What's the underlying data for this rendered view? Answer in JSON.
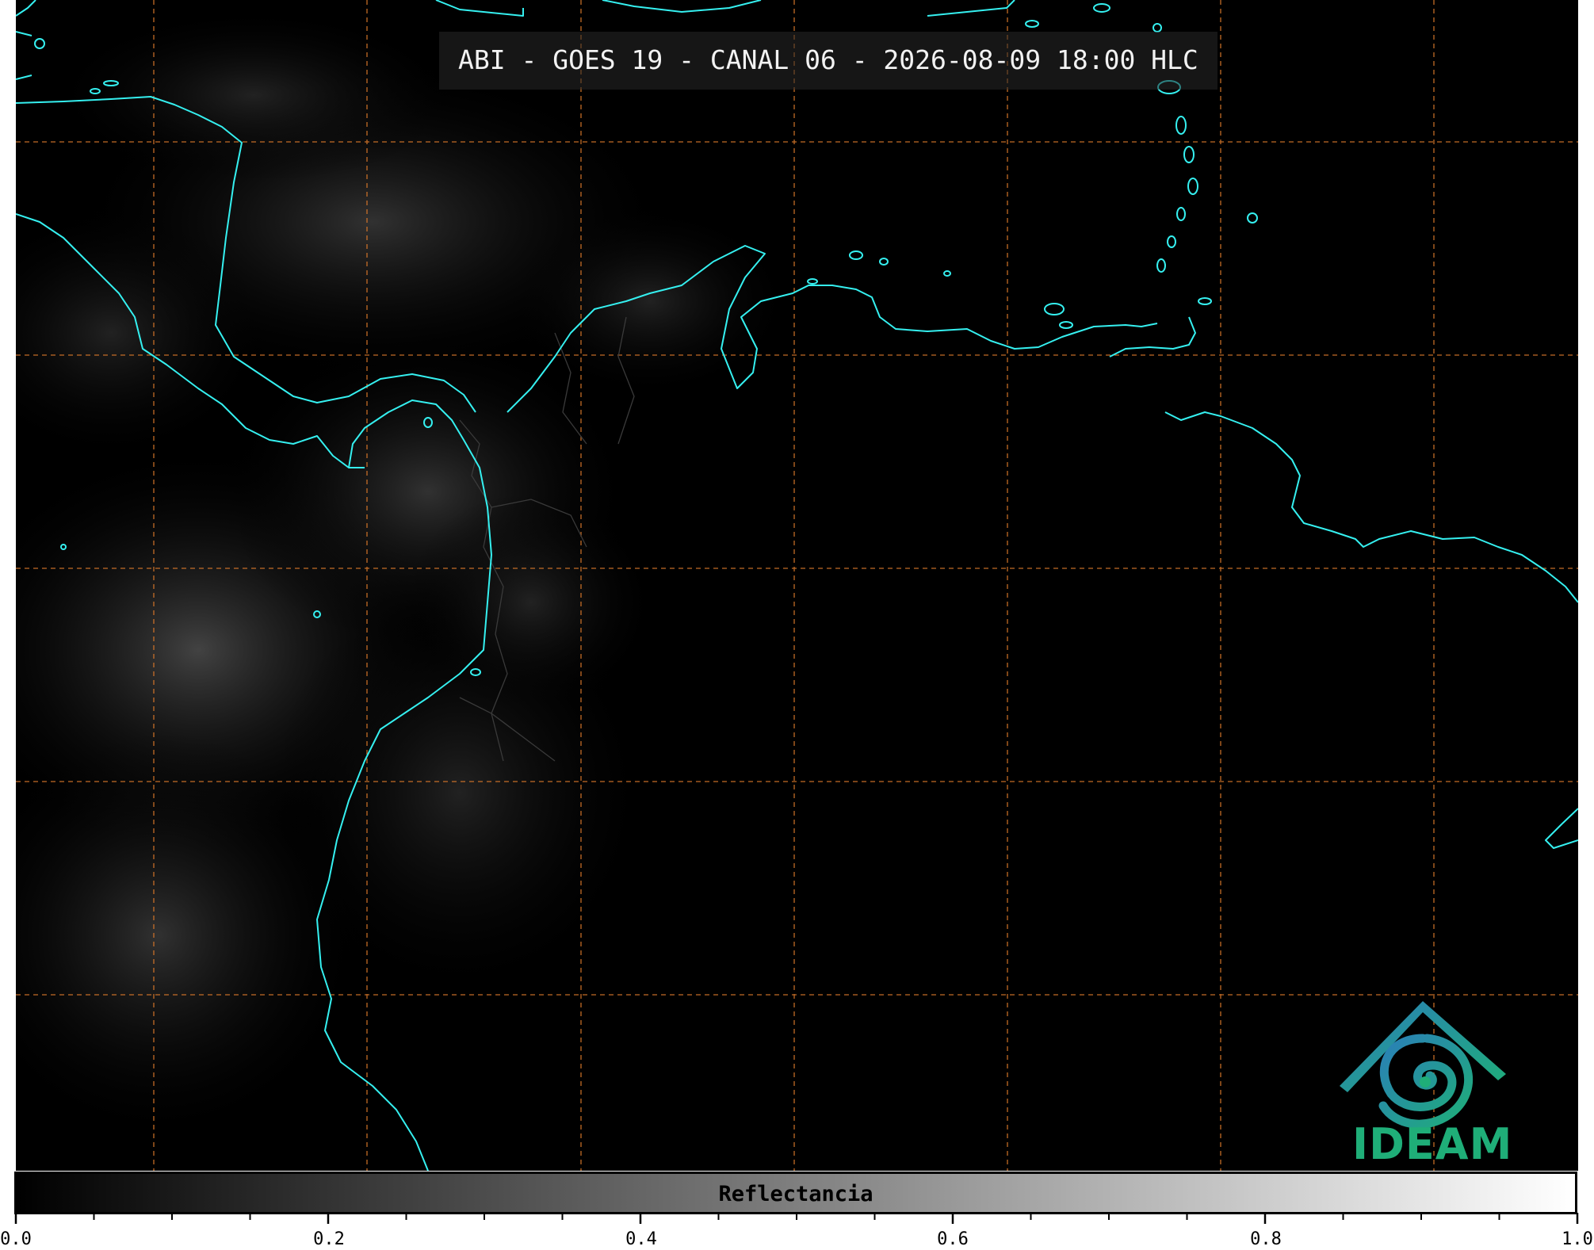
{
  "header": {
    "title": "ABI - GOES 19 - CANAL 06 - 2026-08-09 18:00 HLC"
  },
  "colorbar": {
    "label": "Reflectancia",
    "min": 0.0,
    "max": 1.0,
    "ticks": [
      "0.0",
      "0.2",
      "0.4",
      "0.6",
      "0.8",
      "1.0"
    ]
  },
  "logo": {
    "text": "IDEAM"
  },
  "colors": {
    "coastline": "#35f0f0",
    "grid": "#d8772a",
    "borders": "#3a3a3a",
    "logo_green": "#1fae78",
    "logo_blue": "#2a7fb8"
  }
}
